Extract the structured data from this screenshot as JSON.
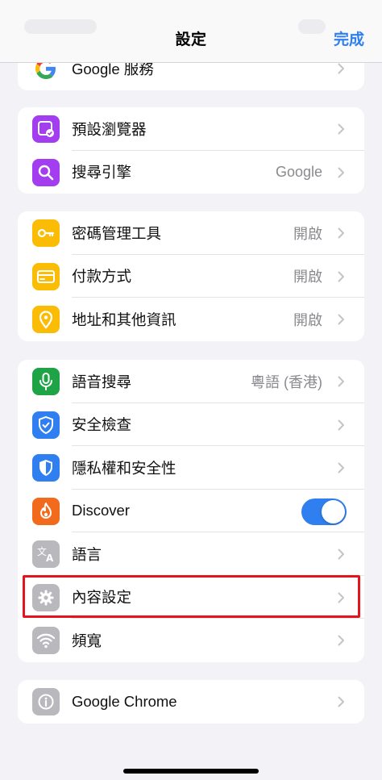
{
  "navbar": {
    "title": "設定",
    "done_label": "完成"
  },
  "groups": [
    {
      "rows": [
        {
          "label": "Google 服務",
          "icon": "google-g-icon"
        }
      ]
    },
    {
      "rows": [
        {
          "label": "預設瀏覽器",
          "icon": "default-browser-icon",
          "icon_color": "#a23df0"
        },
        {
          "label": "搜尋引擎",
          "value": "Google",
          "icon": "search-icon",
          "icon_color": "#a23df0"
        }
      ]
    },
    {
      "rows": [
        {
          "label": "密碼管理工具",
          "value": "開啟",
          "icon": "key-icon",
          "icon_color": "#fbbc05"
        },
        {
          "label": "付款方式",
          "value": "開啟",
          "icon": "credit-card-icon",
          "icon_color": "#fbbc05"
        },
        {
          "label": "地址和其他資訊",
          "value": "開啟",
          "icon": "location-pin-icon",
          "icon_color": "#fbbc05"
        }
      ]
    },
    {
      "rows": [
        {
          "label": "語音搜尋",
          "value": "粵語 (香港)",
          "icon": "microphone-icon",
          "icon_color": "#1ea446"
        },
        {
          "label": "安全檢查",
          "icon": "shield-check-icon",
          "icon_color": "#2f7ff1"
        },
        {
          "label": "隱私權和安全性",
          "icon": "privacy-shield-icon",
          "icon_color": "#2f7ff1"
        },
        {
          "label": "Discover",
          "icon": "fire-icon",
          "icon_color": "#f26b1d",
          "toggle_on": true
        },
        {
          "label": "語言",
          "icon": "translate-icon",
          "icon_color": "#b8b8bd"
        },
        {
          "label": "內容設定",
          "icon": "gear-icon",
          "icon_color": "#b8b8bd"
        },
        {
          "label": "頻寬",
          "icon": "wifi-icon",
          "icon_color": "#b8b8bd"
        }
      ]
    },
    {
      "rows": [
        {
          "label": "Google Chrome",
          "icon": "info-icon",
          "icon_color": "#b8b8bd"
        }
      ]
    }
  ],
  "highlight_color": "#e3141b",
  "accent_color": "#2f7ff1"
}
